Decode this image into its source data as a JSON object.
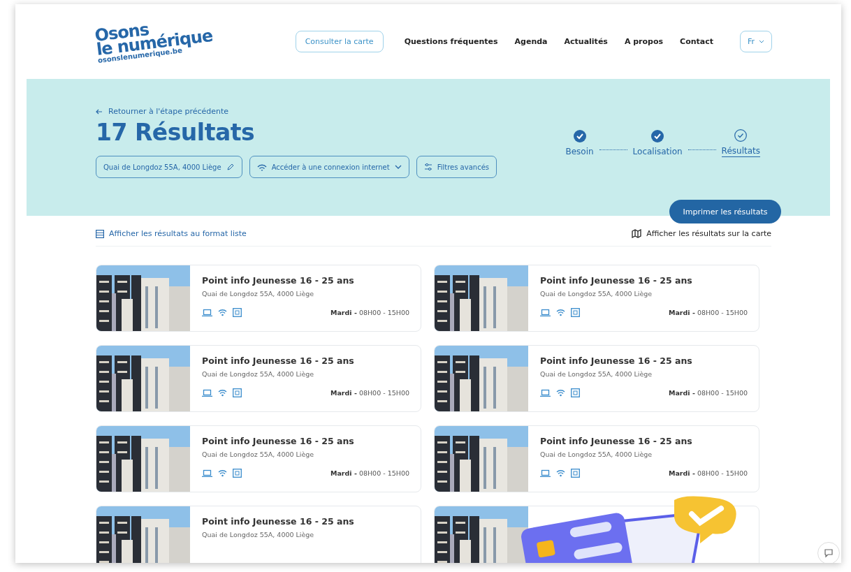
{
  "logo": {
    "lines": [
      "Osons",
      "le numérique"
    ],
    "url": "osonslenumerique.be"
  },
  "nav": {
    "map_button": "Consulter la carte",
    "links": [
      "Questions fréquentes",
      "Agenda",
      "Actualités",
      "A propos",
      "Contact"
    ],
    "language": "Fr"
  },
  "hero": {
    "back_link": "Retourner à l'étape précédente",
    "title": "17 Résultats",
    "filters": [
      {
        "kind": "address",
        "label": "Quai de Longdoz 55A, 4000 Liège"
      },
      {
        "kind": "need",
        "label": "Accéder à une connexion internet"
      },
      {
        "kind": "advanced",
        "label": "Filtres avancés"
      }
    ],
    "steps": [
      {
        "label": "Besoin",
        "completed": true,
        "selected": false
      },
      {
        "label": "Localisation",
        "completed": true,
        "selected": false
      },
      {
        "label": "Résultats",
        "completed": false,
        "selected": true
      }
    ]
  },
  "print_button": "Imprimer les résultats",
  "view_toggle": {
    "list": "Afficher les résultats au format liste",
    "map": "Afficher les résultats sur la carte"
  },
  "results": [
    {
      "kind": "full",
      "title": "Point info Jeunesse 16 - 25 ans",
      "address": "Quai de Longdoz 55A, 4000 Liège",
      "day": "Mardi -",
      "hours": "08H00 - 15H00"
    },
    {
      "kind": "full",
      "title": "Point info Jeunesse 16 - 25 ans",
      "address": "Quai de Longdoz 55A, 4000 Liège",
      "day": "Mardi -",
      "hours": "08H00 - 15H00"
    },
    {
      "kind": "full",
      "title": "Point info Jeunesse 16 - 25 ans",
      "address": "Quai de Longdoz 55A, 4000 Liège",
      "day": "Mardi -",
      "hours": "08H00 - 15H00"
    },
    {
      "kind": "full",
      "title": "Point info Jeunesse 16 - 25 ans",
      "address": "Quai de Longdoz 55A, 4000 Liège",
      "day": "Mardi -",
      "hours": "08H00 - 15H00"
    },
    {
      "kind": "full",
      "title": "Point info Jeunesse 16 - 25 ans",
      "address": "Quai de Longdoz 55A, 4000 Liège",
      "day": "Mardi -",
      "hours": "08H00 - 15H00"
    },
    {
      "kind": "full",
      "title": "Point info Jeunesse 16 - 25 ans",
      "address": "Quai de Longdoz 55A, 4000 Liège",
      "day": "Mardi -",
      "hours": "08H00 - 15H00"
    },
    {
      "kind": "partial",
      "title": "Point info Jeunesse 16 - 25 ans",
      "address": "Quai de Longdoz 55A, 4000 Liège"
    },
    {
      "kind": "covered"
    }
  ]
}
